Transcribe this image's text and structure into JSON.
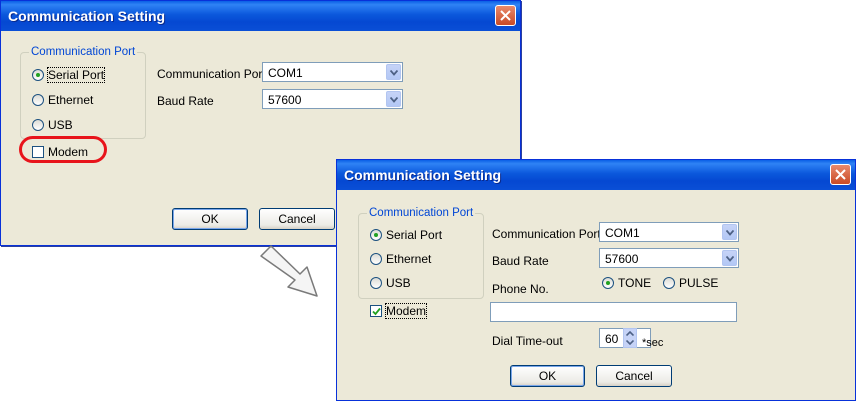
{
  "dialog_back": {
    "title": "Communication Setting",
    "group_label": "Communication Port",
    "port_options": [
      {
        "label": "Serial Port",
        "checked": true
      },
      {
        "label": "Ethernet",
        "checked": false
      },
      {
        "label": "USB",
        "checked": false
      }
    ],
    "modem_label": "Modem",
    "modem_checked": false,
    "comm_port_label": "Communication Port",
    "comm_port_value": "COM1",
    "baud_rate_label": "Baud Rate",
    "baud_rate_value": "57600",
    "ok_label": "OK",
    "cancel_label": "Cancel"
  },
  "dialog_front": {
    "title": "Communication Setting",
    "group_label": "Communication Port",
    "port_options": [
      {
        "label": "Serial Port",
        "checked": true
      },
      {
        "label": "Ethernet",
        "checked": false
      },
      {
        "label": "USB",
        "checked": false
      }
    ],
    "modem_label": "Modem",
    "modem_checked": true,
    "comm_port_label": "Communication Port",
    "comm_port_value": "COM1",
    "baud_rate_label": "Baud Rate",
    "baud_rate_value": "57600",
    "tone_label": "TONE",
    "pulse_label": "PULSE",
    "dial_mode_selected": "TONE",
    "phone_label": "Phone No.",
    "phone_value": "",
    "dial_timeout_label": "Dial Time-out",
    "dial_timeout_value": "60",
    "dial_timeout_unit": "*sec",
    "ok_label": "OK",
    "cancel_label": "Cancel"
  },
  "colors": {
    "titlebar": "#0548d2",
    "dialog_bg": "#ece9d8",
    "group_label": "#0046d5",
    "highlight": "#e8141b",
    "radio_dot": "#21a121",
    "check_mark": "#21a121"
  }
}
